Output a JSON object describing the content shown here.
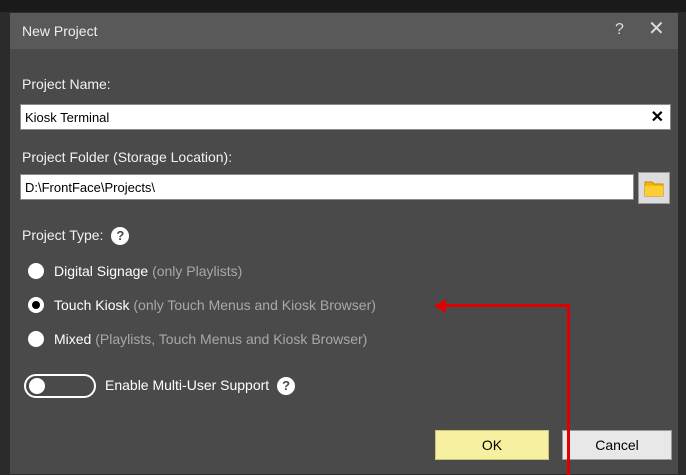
{
  "dialog": {
    "title": "New Project",
    "help_glyph": "?",
    "close_glyph": "✕"
  },
  "project_name": {
    "label": "Project Name:",
    "value": "Kiosk Terminal",
    "clear_glyph": "✕"
  },
  "project_folder": {
    "label": "Project Folder (Storage Location):",
    "value": "D:\\FrontFace\\Projects\\",
    "browse_icon": "folder-icon"
  },
  "project_type": {
    "label": "Project Type:",
    "help_glyph": "?",
    "options": [
      {
        "label": "Digital Signage",
        "hint": "(only Playlists)",
        "selected": false
      },
      {
        "label": "Touch Kiosk",
        "hint": "(only Touch Menus and Kiosk Browser)",
        "selected": true
      },
      {
        "label": "Mixed",
        "hint": "(Playlists, Touch Menus and Kiosk Browser)",
        "selected": false
      }
    ]
  },
  "multi_user": {
    "label": "Enable Multi-User Support",
    "enabled": false,
    "help_glyph": "?"
  },
  "buttons": {
    "ok": "OK",
    "cancel": "Cancel"
  },
  "colors": {
    "dialog_bg": "#4a4a4a",
    "titlebar_bg": "#595959",
    "ok_button": "#f7f0a0",
    "annotation_arrow": "#e00000"
  }
}
